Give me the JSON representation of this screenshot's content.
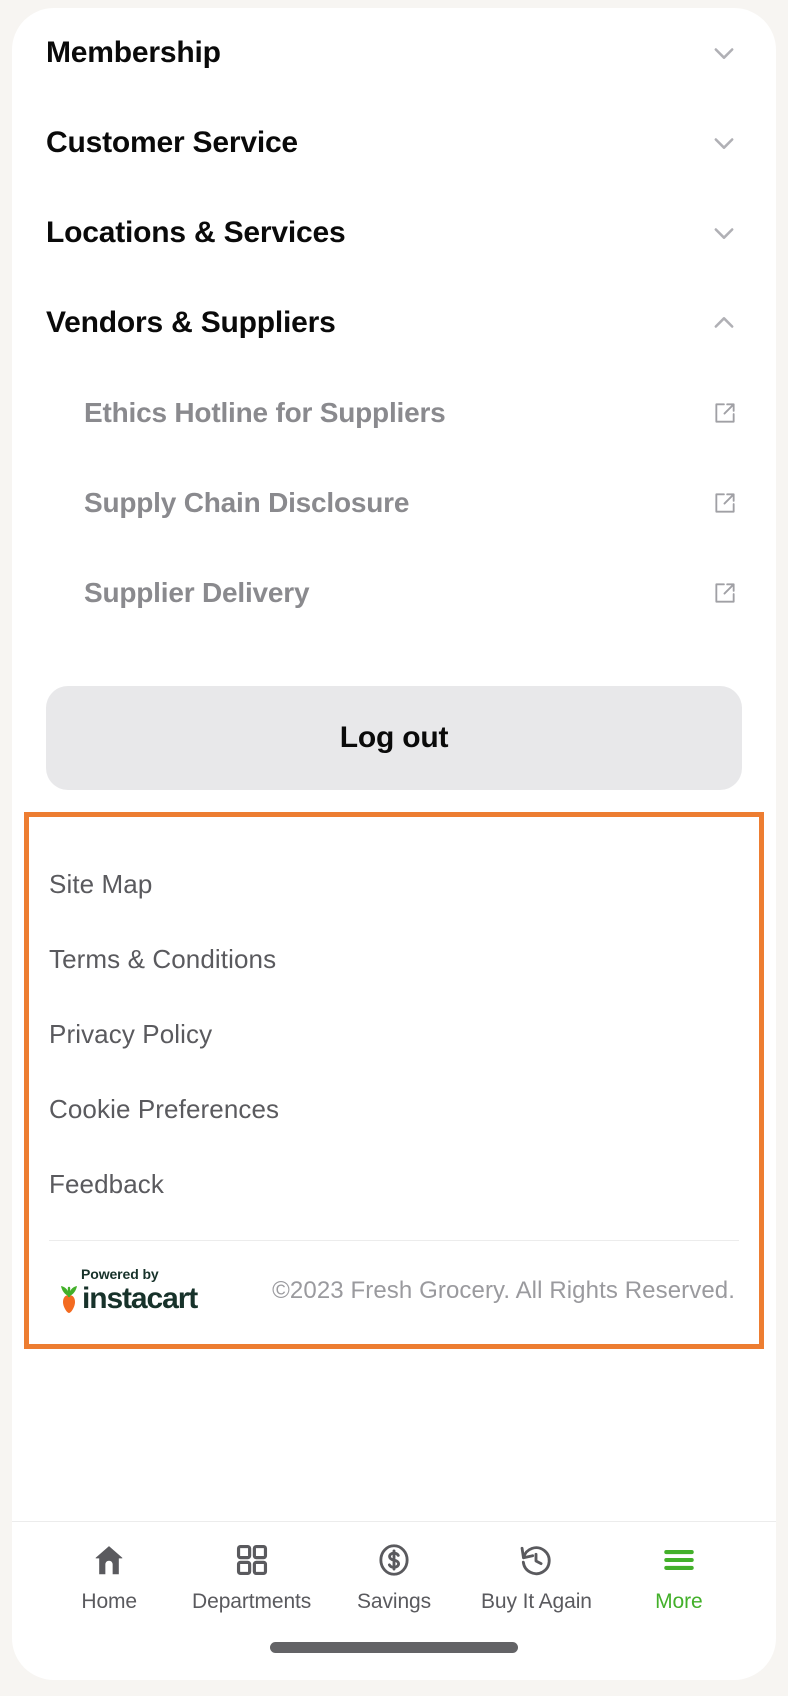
{
  "accordion": {
    "sections": [
      {
        "label": "Membership",
        "expanded": false,
        "chevron": "chevron-down-icon"
      },
      {
        "label": "Customer Service",
        "expanded": false,
        "chevron": "chevron-down-icon"
      },
      {
        "label": "Locations & Services",
        "expanded": false,
        "chevron": "chevron-down-icon"
      },
      {
        "label": "Vendors & Suppliers",
        "expanded": true,
        "chevron": "chevron-up-icon"
      }
    ],
    "vendor_items": [
      {
        "label": "Ethics Hotline for Suppliers",
        "icon": "external-link-icon"
      },
      {
        "label": "Supply Chain Disclosure",
        "icon": "external-link-icon"
      },
      {
        "label": "Supplier Delivery",
        "icon": "external-link-icon"
      }
    ]
  },
  "logout": {
    "label": "Log out"
  },
  "footer": {
    "highlight_color": "#ed7d31",
    "links": [
      {
        "label": "Site Map"
      },
      {
        "label": "Terms & Conditions"
      },
      {
        "label": "Privacy Policy"
      },
      {
        "label": "Cookie Preferences"
      },
      {
        "label": "Feedback"
      }
    ],
    "powered_by": "Powered by",
    "brand": "instacart",
    "brand_color": "#17322a",
    "carrot_color": "#f36b21",
    "leaf_color": "#43b02a",
    "copyright": "©2023 Fresh Grocery. All Rights Reserved."
  },
  "tabbar": {
    "active_color": "#43b02a",
    "items": [
      {
        "label": "Home",
        "icon": "home-icon",
        "active": false
      },
      {
        "label": "Departments",
        "icon": "grid-icon",
        "active": false
      },
      {
        "label": "Savings",
        "icon": "dollar-circle-icon",
        "active": false
      },
      {
        "label": "Buy It Again",
        "icon": "history-clock-icon",
        "active": false
      },
      {
        "label": "More",
        "icon": "hamburger-menu-icon",
        "active": true
      }
    ]
  }
}
